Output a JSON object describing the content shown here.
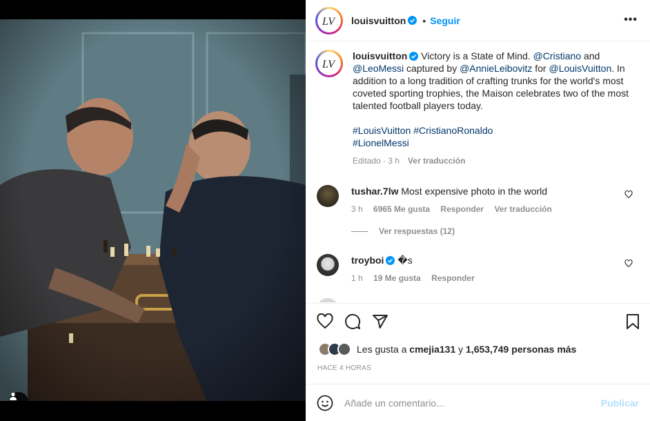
{
  "post": {
    "username": "louisvuitton",
    "follow_label": "Seguir",
    "separator": "•",
    "more_label": "•••",
    "logo_text": "LV"
  },
  "caption": {
    "username": "louisvuitton",
    "part1": " Victory is a State of Mind. ",
    "mention1": "@Cristiano",
    "part2": " and ",
    "mention2": "@LeoMessi",
    "part3": " captured by ",
    "mention3": "@AnnieLeibovitz",
    "part4": " for ",
    "mention4": "@LouisVuitton",
    "part5": ". In addition to a long tradition of crafting trunks for the world's most coveted sporting trophies, the Maison celebrates two of the most talented football players today.",
    "hashtag1": "#LouisVuitton",
    "hashtag2": "#CristianoRonaldo",
    "hashtag3": "#LionelMessi",
    "edited": "Editado · 3 h",
    "translate": "Ver traducción"
  },
  "comments": [
    {
      "username": "tushar.7lw",
      "text": "Most expensive photo in the world",
      "time": "3 h",
      "likes": "6965 Me gusta",
      "reply": "Responder",
      "translate": "Ver traducción"
    },
    {
      "username": "troyboi",
      "text": "�s",
      "time": "1 h",
      "likes": "19 Me gusta",
      "reply": "Responder"
    }
  ],
  "view_replies": "Ver respuestas (12)",
  "likes": {
    "prefix": "Les gusta a ",
    "user": "cmejia131",
    "middle": " y ",
    "count": "1,653,749 personas más"
  },
  "timestamp": "HACE 4 HORAS",
  "composer": {
    "placeholder": "Añade un comentario...",
    "publish": "Publicar"
  },
  "colors": {
    "accent": "#0095f6",
    "link": "#00376b",
    "muted": "#8e8e8e",
    "publish_disabled": "#b2dffc"
  },
  "icons": [
    "heart-icon",
    "comment-icon",
    "share-icon",
    "bookmark-icon",
    "emoji-icon",
    "verified-icon",
    "more-icon",
    "user-tag-icon"
  ]
}
